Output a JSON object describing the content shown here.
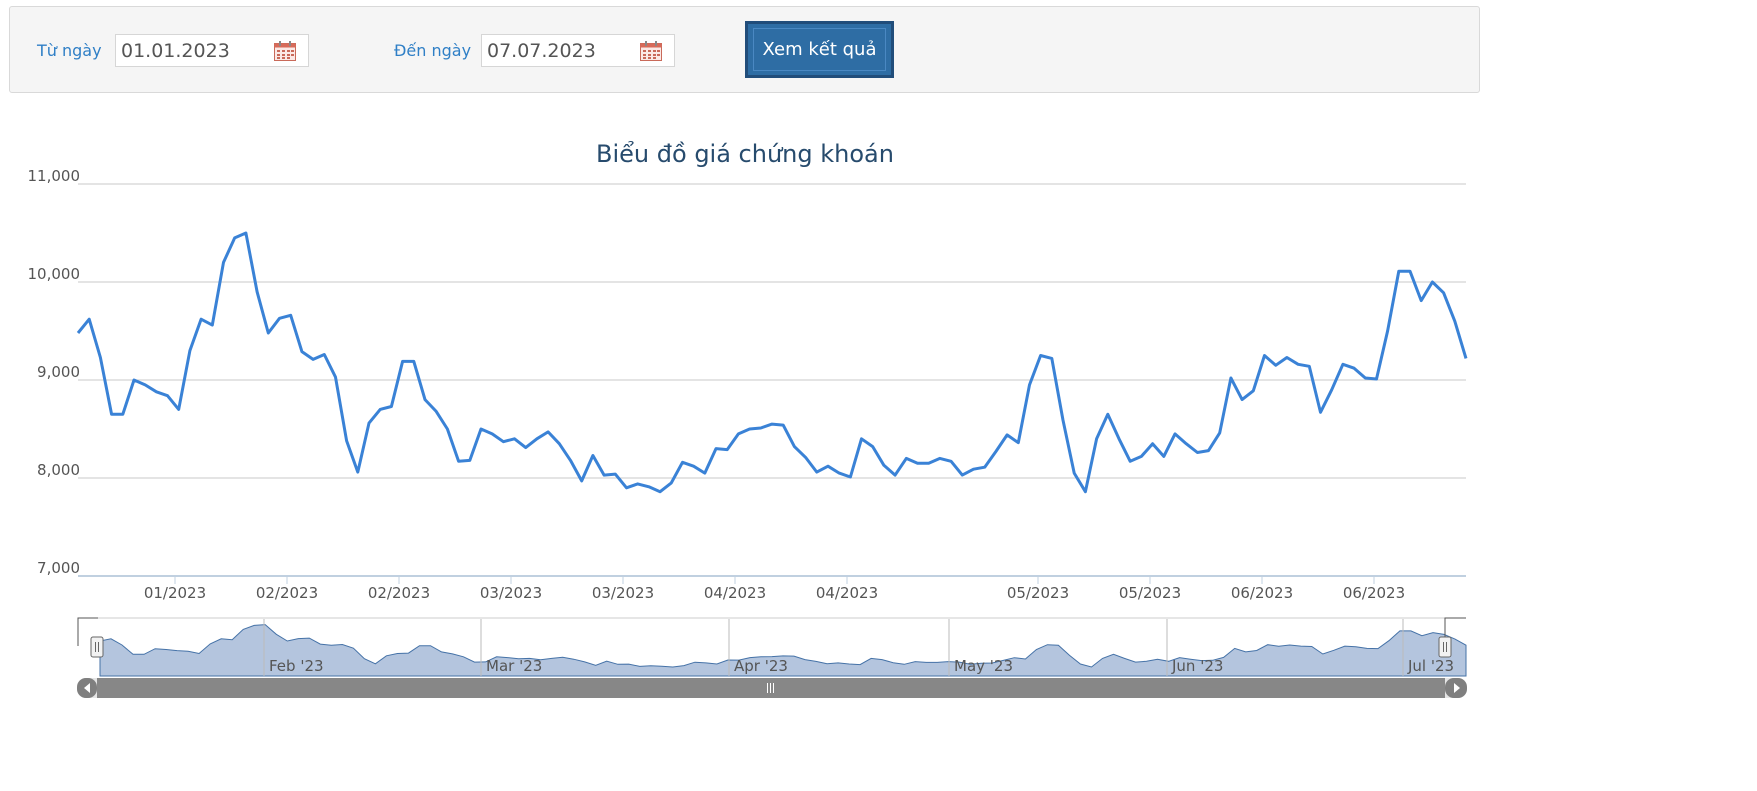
{
  "filter": {
    "from_label": "Từ ngày",
    "from_value": "01.01.2023",
    "to_label": "Đến ngày",
    "to_value": "07.07.2023",
    "submit_label": "Xem kết quả"
  },
  "colors": {
    "line": "#3a82d6",
    "navigator_fill": "#b4c5de",
    "button": "#2e6da4",
    "label": "#2f7fc6"
  },
  "chart_data": {
    "type": "line",
    "title": "Biểu đồ giá chứng khoán",
    "ylim": [
      7000,
      11000
    ],
    "yticks": [
      "11,000",
      "10,000",
      "9,000",
      "8,000",
      "7,000"
    ],
    "grid": true,
    "legend": "none",
    "xtick_labels": [
      "01/2023",
      "02/2023",
      "02/2023",
      "03/2023",
      "03/2023",
      "04/2023",
      "04/2023",
      "05/2023",
      "05/2023",
      "06/2023",
      "06/2023"
    ],
    "navigator_labels": [
      "Feb '23",
      "Mar '23",
      "Apr '23",
      "May '23",
      "Jun '23",
      "Jul '23"
    ],
    "series": [
      {
        "values": [
          9480,
          9620,
          9230,
          8650,
          8650,
          9000,
          8950,
          8880,
          8840,
          8700,
          9300,
          9620,
          9560,
          10200,
          10450,
          10500,
          9900,
          9480,
          9630,
          9660,
          9290,
          9210,
          9260,
          9030,
          8380,
          8060,
          8560,
          8700,
          8730,
          9190,
          9190,
          8800,
          8680,
          8500,
          8170,
          8180,
          8500,
          8450,
          8370,
          8400,
          8310,
          8400,
          8470,
          8350,
          8180,
          7970,
          8230,
          8030,
          8040,
          7900,
          7940,
          7910,
          7860,
          7950,
          8160,
          8120,
          8050,
          8300,
          8290,
          8450,
          8500,
          8510,
          8550,
          8540,
          8320,
          8210,
          8060,
          8120,
          8050,
          8010,
          8400,
          8320,
          8130,
          8030,
          8200,
          8150,
          8150,
          8200,
          8170,
          8030,
          8090,
          8110,
          8270,
          8440,
          8360,
          8950,
          9250,
          9220,
          8590,
          8050,
          7860,
          8400,
          8650,
          8400,
          8170,
          8220,
          8350,
          8220,
          8450,
          8350,
          8260,
          8280,
          8460,
          9020,
          8800,
          8890,
          9250,
          9150,
          9230,
          9160,
          9140,
          8670,
          8900,
          9160,
          9120,
          9020,
          9010,
          9500,
          10110,
          10110,
          9810,
          10000,
          9890,
          9600,
          9220
        ]
      }
    ]
  }
}
